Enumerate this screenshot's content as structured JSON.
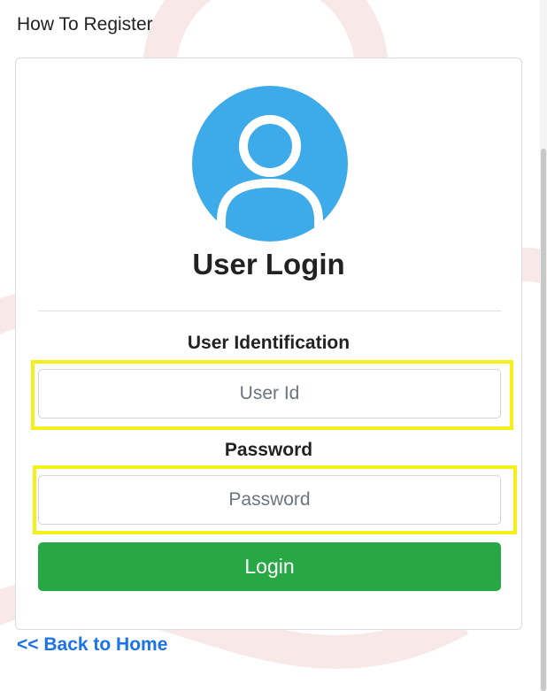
{
  "header": {
    "register_link": "How To Register"
  },
  "login_card": {
    "avatar_icon": "user-circle-icon",
    "title": "User Login",
    "user_id": {
      "label": "User Identification",
      "placeholder": "User Id",
      "value": ""
    },
    "password": {
      "label": "Password",
      "placeholder": "Password",
      "value": ""
    },
    "login_button": "Login"
  },
  "footer": {
    "back_link": "<< Back to Home"
  },
  "colors": {
    "avatar": "#3daae9",
    "login_button": "#28a745",
    "link": "#1a73e8",
    "highlight": "#f5ef1a"
  }
}
